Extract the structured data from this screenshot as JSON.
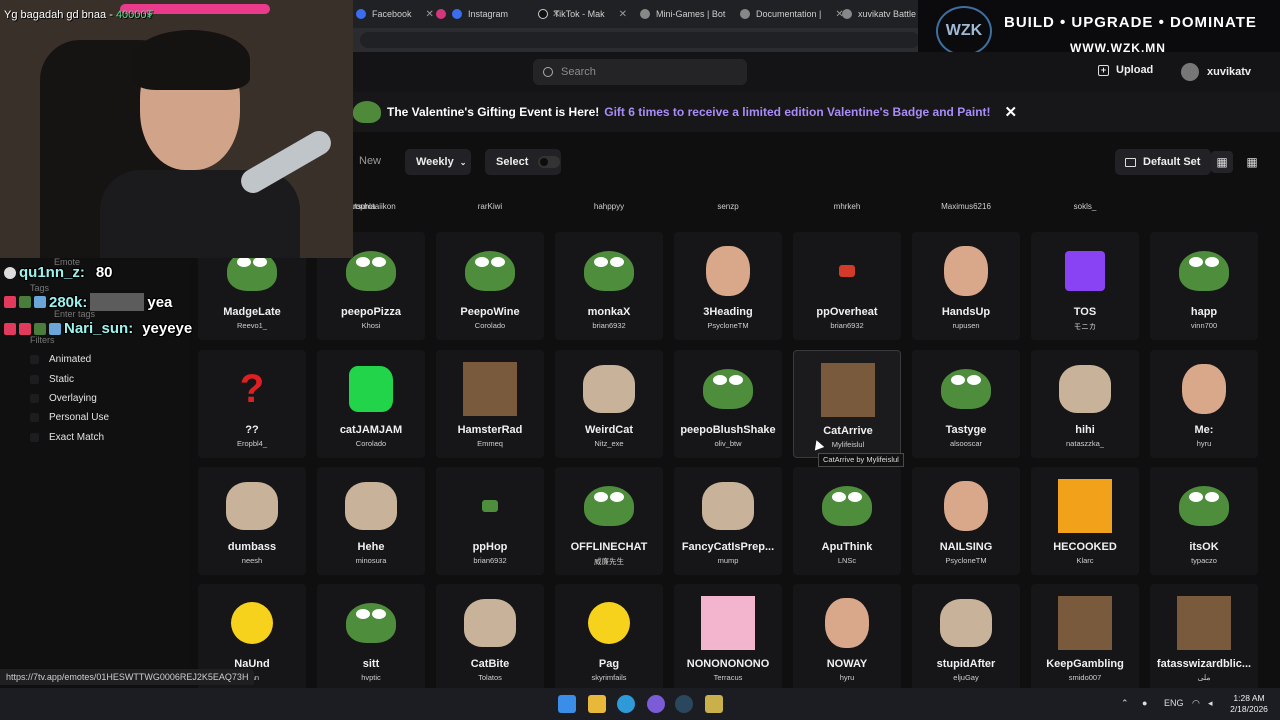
{
  "browser": {
    "tabs": [
      {
        "label": "Facebook",
        "icon": "facebook-icon"
      },
      {
        "label": "Instagram",
        "icon": "instagram-icon"
      },
      {
        "label": "TikTok - Mak",
        "icon": "tiktok-icon"
      },
      {
        "label": "Mini-Games | Bot",
        "icon": "game-icon"
      },
      {
        "label": "Documentation | ",
        "icon": "docs-icon"
      },
      {
        "label": "xuvikatv Battle | ",
        "icon": "battle-icon"
      }
    ]
  },
  "overlay_banner": {
    "logo": "WZK",
    "tagline": "BUILD • UPGRADE • DOMINATE",
    "url": "WWW.WZK.MN"
  },
  "webcam": {
    "top_text": "Yg bagadah gd bnaa - ",
    "top_value": "40000₮"
  },
  "header": {
    "search_placeholder": "Search",
    "upload_label": "Upload",
    "username": "xuvikatv"
  },
  "announcement": {
    "text": "The Valentine's Gifting Event is Here!",
    "link": "Gift 6 times to receive a limited edition Valentine's Badge and Paint!",
    "close": "✕"
  },
  "toolbar": {
    "new_label": "New",
    "weekly_label": "Weekly",
    "select_label": "Select",
    "default_set_label": "Default Set"
  },
  "top_row_owners": [
    "orophia",
    "kutsurotaiikon",
    "rarKiwi",
    "hahppyy",
    "senzp",
    "mhrkeh",
    "Maximus6216",
    "sokls_"
  ],
  "emotes": [
    [
      {
        "name": "MadgeLate",
        "owner": "Reevo1_",
        "art": "frog"
      },
      {
        "name": "peepoPizza",
        "owner": "Khosi",
        "art": "frog"
      },
      {
        "name": "PeepoWine",
        "owner": "Corolado",
        "art": "frog"
      },
      {
        "name": "monkaX",
        "owner": "brian6932",
        "art": "frog"
      },
      {
        "name": "3Heading",
        "owner": "PsycloneTM",
        "art": "face"
      },
      {
        "name": "ppOverheat",
        "owner": "brian6932",
        "art": "small"
      },
      {
        "name": "HandsUp",
        "owner": "rupusen",
        "art": "face"
      },
      {
        "name": "TOS",
        "owner": "モニカ",
        "art": "purple"
      },
      {
        "name": "happ",
        "owner": "vinn700",
        "art": "frog"
      }
    ],
    [
      {
        "name": "??",
        "owner": "Eropbl4_",
        "art": "qmark"
      },
      {
        "name": "catJAMJAM",
        "owner": "Corolado",
        "art": "blob"
      },
      {
        "name": "HamsterRad",
        "owner": "Emmeq",
        "art": "photo"
      },
      {
        "name": "WeirdCat",
        "owner": "Nitz_exe",
        "art": "cat"
      },
      {
        "name": "peepoBlushShake",
        "owner": "oliv_btw",
        "art": "frog"
      },
      {
        "name": "CatArrive",
        "owner": "Mylifeislul",
        "art": "photo"
      },
      {
        "name": "Tastyge",
        "owner": "alsooscar",
        "art": "frog"
      },
      {
        "name": "hihi",
        "owner": "nataszzka_",
        "art": "cat"
      },
      {
        "name": "Me:",
        "owner": "hyru",
        "art": "face"
      }
    ],
    [
      {
        "name": "dumbass",
        "owner": "neesh",
        "art": "cat"
      },
      {
        "name": "Hehe",
        "owner": "minosura",
        "art": "cat"
      },
      {
        "name": "ppHop",
        "owner": "brian6932",
        "art": "small"
      },
      {
        "name": "OFFLINECHAT",
        "owner": "威廉先生",
        "art": "frog"
      },
      {
        "name": "FancyCatIsPrep...",
        "owner": "mump",
        "art": "cat"
      },
      {
        "name": "ApuThink",
        "owner": "LNSc",
        "art": "frog"
      },
      {
        "name": "NAILSING",
        "owner": "PsycloneTM",
        "art": "face"
      },
      {
        "name": "HECOOKED",
        "owner": "Klarc",
        "art": "fire"
      },
      {
        "name": "itsOK",
        "owner": "typaczo",
        "art": "frog"
      }
    ],
    [
      {
        "name": "NaUnd",
        "owner": "nian",
        "art": "ball"
      },
      {
        "name": "sitt",
        "owner": "hvptic",
        "art": "frog"
      },
      {
        "name": "CatBite",
        "owner": "Tolatos",
        "art": "cat"
      },
      {
        "name": "Pag",
        "owner": "skyrimfails",
        "art": "ball"
      },
      {
        "name": "NONONONONO",
        "owner": "Terracus",
        "art": "pink"
      },
      {
        "name": "NOWAY",
        "owner": "hyru",
        "art": "face"
      },
      {
        "name": "stupidAfter",
        "owner": "eljuGay",
        "art": "cat"
      },
      {
        "name": "KeepGambling",
        "owner": "smido007",
        "art": "photo"
      },
      {
        "name": "fatasswizardblic...",
        "owner": "ملی",
        "art": "photo"
      }
    ]
  ],
  "tooltip": "CatArrive by Mylifeislul",
  "left_panel": {
    "emote_label": "Emote",
    "tags_label": "Tags",
    "tags_placeholder": "Enter tags",
    "filters_label": "Filters",
    "filters": [
      "Animated",
      "Static",
      "Overlaying",
      "Personal Use",
      "Exact Match"
    ]
  },
  "chat": [
    {
      "name": "qu1nn_z:",
      "message": "80"
    },
    {
      "name": "280k:",
      "message": "yea"
    },
    {
      "name": "Nari_sun:",
      "message": "yeyeye"
    }
  ],
  "status_url": "https://7tv.app/emotes/01HESWTTWG0006REJ2K5EAQ73H",
  "taskbar": {
    "language": "ENG",
    "time": "1:28 AM",
    "date": "2/18/2026"
  },
  "colors": {
    "accent_link": "#a98cf7",
    "frog_green": "#4e8d3c",
    "background": "#0f0f10"
  }
}
